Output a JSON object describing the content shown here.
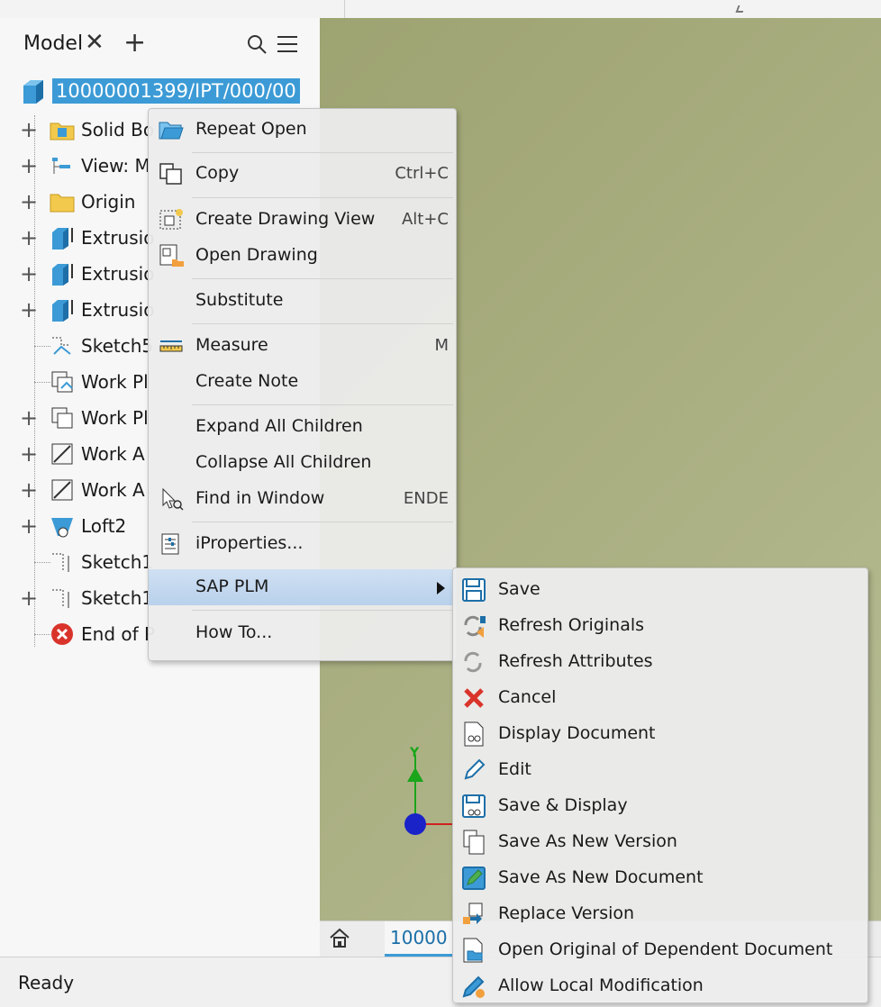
{
  "browser": {
    "tab_label": "Model",
    "root_label": "10000001399/IPT/000/00",
    "items": [
      {
        "label": "Solid Bo",
        "icon": "solid-bodies-folder-icon",
        "expandable": true
      },
      {
        "label": "View: M",
        "icon": "view-rep-icon",
        "expandable": true
      },
      {
        "label": "Origin",
        "icon": "origin-folder-icon",
        "expandable": true
      },
      {
        "label": "Extrusio",
        "icon": "extrusion-icon",
        "expandable": true
      },
      {
        "label": "Extrusio",
        "icon": "extrusion-icon",
        "expandable": true
      },
      {
        "label": "Extrusio",
        "icon": "extrusion-icon",
        "expandable": true
      },
      {
        "label": "Sketch5",
        "icon": "sketch-icon",
        "expandable": false
      },
      {
        "label": "Work Pl",
        "icon": "work-plane-icon",
        "expandable": false
      },
      {
        "label": "Work Pl",
        "icon": "work-plane-icon",
        "expandable": true
      },
      {
        "label": "Work A",
        "icon": "work-axis-icon",
        "expandable": true
      },
      {
        "label": "Work A",
        "icon": "work-axis-icon",
        "expandable": true
      },
      {
        "label": "Loft2",
        "icon": "loft-icon",
        "expandable": true
      },
      {
        "label": "Sketch1",
        "icon": "sketch-icon",
        "expandable": false
      },
      {
        "label": "Sketch1",
        "icon": "sketch-icon",
        "expandable": true
      },
      {
        "label": "End of P",
        "icon": "end-of-part-icon",
        "expandable": false
      }
    ]
  },
  "context_menu": {
    "items": [
      {
        "label": "Repeat Open",
        "shortcut": "",
        "icon": "folder-open-icon"
      },
      {
        "label": "Copy",
        "shortcut": "Ctrl+C",
        "icon": "copy-icon"
      },
      {
        "label": "Create Drawing View",
        "shortcut": "Alt+C",
        "icon": "drawing-view-icon"
      },
      {
        "label": "Open Drawing",
        "shortcut": "",
        "icon": "open-drawing-icon"
      },
      {
        "label": "Substitute",
        "shortcut": "",
        "icon": ""
      },
      {
        "label": "Measure",
        "shortcut": "M",
        "icon": "measure-icon"
      },
      {
        "label": "Create Note",
        "shortcut": "",
        "icon": ""
      },
      {
        "label": "Expand All Children",
        "shortcut": "",
        "icon": ""
      },
      {
        "label": "Collapse All Children",
        "shortcut": "",
        "icon": ""
      },
      {
        "label": "Find in Window",
        "shortcut": "ENDE",
        "icon": "find-in-window-icon"
      },
      {
        "label": "iProperties...",
        "shortcut": "",
        "icon": "iproperties-icon"
      },
      {
        "label": "SAP PLM",
        "shortcut": "",
        "icon": ""
      },
      {
        "label": "How To...",
        "shortcut": "",
        "icon": ""
      }
    ]
  },
  "sap_submenu": {
    "items": [
      {
        "label": "Save",
        "icon": "save-icon"
      },
      {
        "label": "Refresh Originals",
        "icon": "refresh-originals-icon"
      },
      {
        "label": "Refresh Attributes",
        "icon": "refresh-attributes-icon"
      },
      {
        "label": "Cancel",
        "icon": "cancel-icon"
      },
      {
        "label": "Display Document",
        "icon": "display-document-icon"
      },
      {
        "label": "Edit",
        "icon": "edit-pencil-icon"
      },
      {
        "label": "Save & Display",
        "icon": "save-display-icon"
      },
      {
        "label": "Save As New Version",
        "icon": "new-version-icon"
      },
      {
        "label": "Save As New Document",
        "icon": "new-document-icon"
      },
      {
        "label": "Replace Version",
        "icon": "replace-version-icon"
      },
      {
        "label": "Open Original of Dependent Document",
        "icon": "open-original-icon"
      },
      {
        "label": "Allow Local Modification",
        "icon": "allow-modification-icon"
      }
    ]
  },
  "viewport": {
    "axis_label": "Y",
    "doc_tab": "10000"
  },
  "status": "Ready",
  "colors": {
    "accent": "#3c9bd6",
    "viewport": "#a9ae80",
    "highlight": "#c4d9f0"
  }
}
